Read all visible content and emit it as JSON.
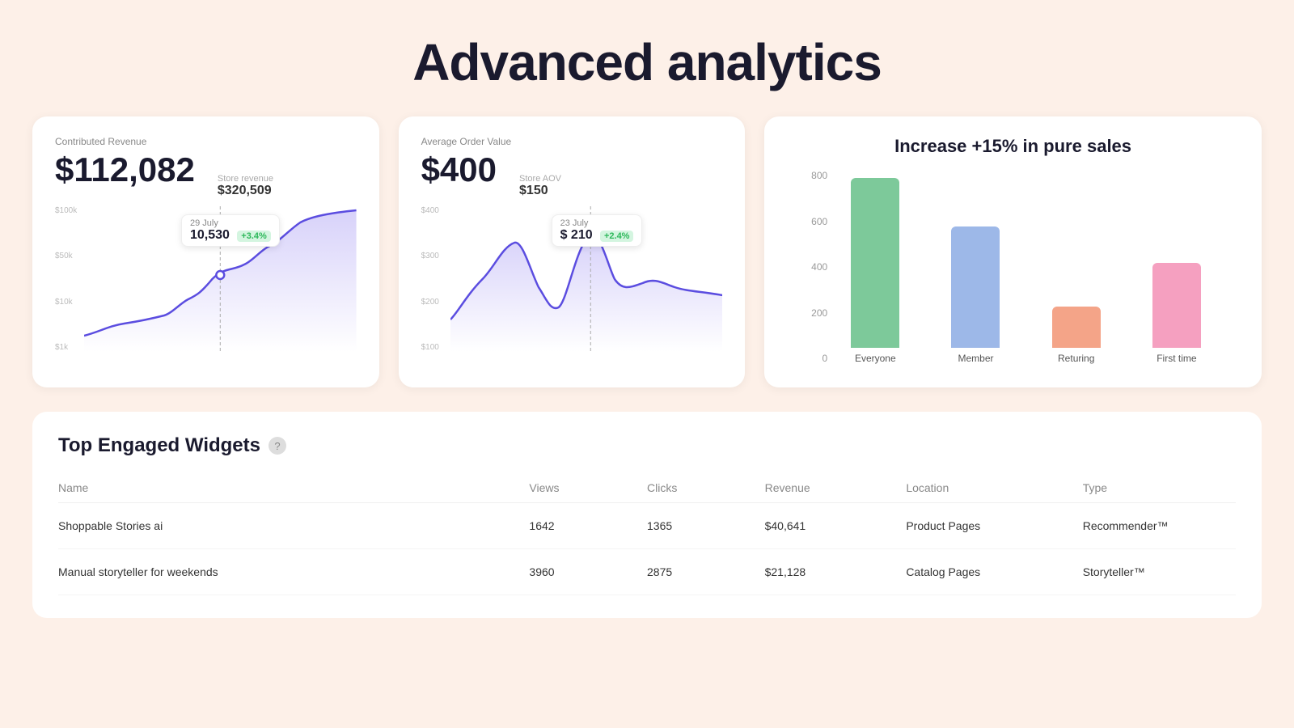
{
  "page": {
    "title": "Advanced analytics",
    "background": "#fdf0e8"
  },
  "revenue_card": {
    "label": "Contributed Revenue",
    "main_value": "$112,082",
    "sub_label": "Store revenue",
    "sub_value": "$320,509",
    "y_axis": [
      "$100k",
      "$50k",
      "$10k",
      "$1k"
    ],
    "tooltip": {
      "date": "29 July",
      "value": "10,530",
      "badge": "+3.4%"
    }
  },
  "aov_card": {
    "label": "Average Order Value",
    "main_value": "$400",
    "sub_label": "Store AOV",
    "sub_value": "$150",
    "y_axis": [
      "$400",
      "$300",
      "$200",
      "$100"
    ],
    "tooltip": {
      "date": "23 July",
      "value": "$ 210",
      "badge": "+2.4%"
    }
  },
  "bar_chart": {
    "title": "Increase +15% in pure sales",
    "y_labels": [
      "800",
      "600",
      "400",
      "200",
      "0"
    ],
    "bars": [
      {
        "label": "Everyone",
        "value": 700,
        "color": "#7dc99a"
      },
      {
        "label": "Member",
        "value": 500,
        "color": "#9db8e8"
      },
      {
        "label": "Returing",
        "value": 170,
        "color": "#f4a488"
      },
      {
        "label": "First time",
        "value": 350,
        "color": "#f5a0c0"
      }
    ],
    "max_value": 800
  },
  "widgets_table": {
    "title": "Top Engaged Widgets",
    "help_icon": "?",
    "columns": [
      "Name",
      "Views",
      "Clicks",
      "Revenue",
      "Location",
      "Type"
    ],
    "rows": [
      {
        "name": "Shoppable Stories ai",
        "views": "1642",
        "clicks": "1365",
        "revenue": "$40,641",
        "location": "Product Pages",
        "type": "Recommender™"
      },
      {
        "name": "Manual storyteller for weekends",
        "views": "3960",
        "clicks": "2875",
        "revenue": "$21,128",
        "location": "Catalog Pages",
        "type": "Storyteller™"
      }
    ]
  }
}
